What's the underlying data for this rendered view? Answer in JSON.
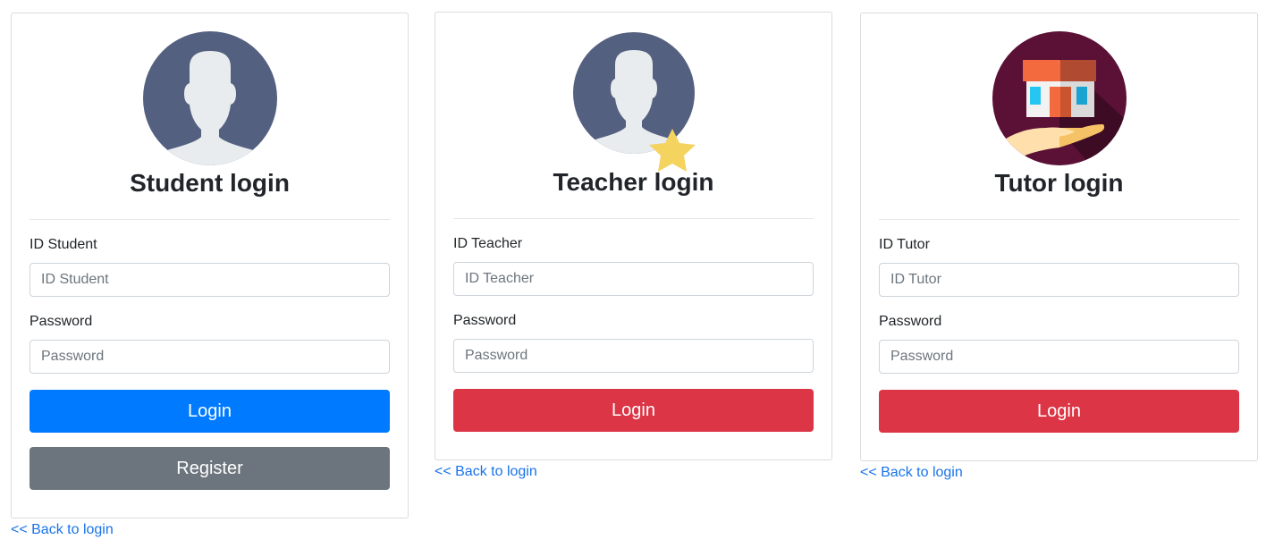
{
  "colors": {
    "primary": "#007bff",
    "danger": "#dc3545",
    "secondary": "#6c757d",
    "link": "#1a73e8"
  },
  "student": {
    "avatar_icon": "user-avatar-icon",
    "title": "Student login",
    "id_label": "ID Student",
    "id_placeholder": "ID Student",
    "password_label": "Password",
    "password_placeholder": "Password",
    "login_label": "Login",
    "register_label": "Register",
    "back_link": "<< Back to login"
  },
  "teacher": {
    "avatar_icon": "teacher-star-avatar-icon",
    "title": "Teacher login",
    "id_label": "ID Teacher",
    "id_placeholder": "ID Teacher",
    "password_label": "Password",
    "password_placeholder": "Password",
    "login_label": "Login",
    "back_link": "<< Back to login"
  },
  "tutor": {
    "avatar_icon": "house-in-hand-icon",
    "title": "Tutor login",
    "id_label": "ID Tutor",
    "id_placeholder": "ID Tutor",
    "password_label": "Password",
    "password_placeholder": "Password",
    "login_label": "Login",
    "back_link": "<< Back to login"
  }
}
